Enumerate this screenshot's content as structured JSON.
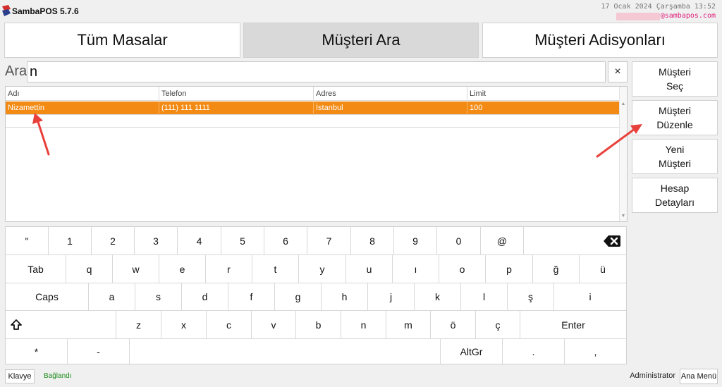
{
  "app": {
    "title": "SambaPOS 5.7.6",
    "datetime": "17 Ocak 2024 Çarşamba 13:52",
    "email_suffix": "@sambapos.com"
  },
  "tabs": [
    {
      "label": "Tüm Masalar"
    },
    {
      "label": "Müşteri Ara",
      "active": true
    },
    {
      "label": "Müşteri Adisyonları"
    }
  ],
  "search": {
    "label": "Ara",
    "value": "n",
    "clear_label": "×"
  },
  "grid": {
    "columns": [
      "Adı",
      "Telefon",
      "Adres",
      "Limit"
    ],
    "rows": [
      {
        "cells": [
          "Nizamettin",
          "(111) 111 1111",
          "İstanbul",
          "100"
        ],
        "selected": true
      }
    ],
    "scroll_up": "▲",
    "scroll_down": "▼"
  },
  "side_buttons": [
    {
      "label": "Müşteri\nSeç"
    },
    {
      "label": "Müşteri\nDüzenle"
    },
    {
      "label": "Yeni\nMüşteri"
    },
    {
      "label": "Hesap\nDetayları"
    }
  ],
  "keyboard": {
    "rows": [
      [
        "\"",
        "1",
        "2",
        "3",
        "4",
        "5",
        "6",
        "7",
        "8",
        "9",
        "0",
        "@",
        "backspace-icon"
      ],
      [
        "Tab",
        "q",
        "w",
        "e",
        "r",
        "t",
        "y",
        "u",
        "ı",
        "o",
        "p",
        "ğ",
        "ü"
      ],
      [
        "Caps",
        "a",
        "s",
        "d",
        "f",
        "g",
        "h",
        "j",
        "k",
        "l",
        "ş",
        "i"
      ],
      [
        "shift-icon",
        "z",
        "x",
        "c",
        "v",
        "b",
        "n",
        "m",
        "ö",
        "ç",
        "Enter"
      ],
      [
        "*",
        "-",
        "",
        "AltGr",
        ".",
        ","
      ]
    ]
  },
  "footer": {
    "keyboard_button": "Klavye",
    "status": "Bağlandı",
    "user": "Administrator",
    "menu_button": "Ana Menü"
  },
  "colors": {
    "selected_row": "#f28a13",
    "status_ok": "#1e8c1e",
    "annotation_arrow": "#e8413c"
  }
}
